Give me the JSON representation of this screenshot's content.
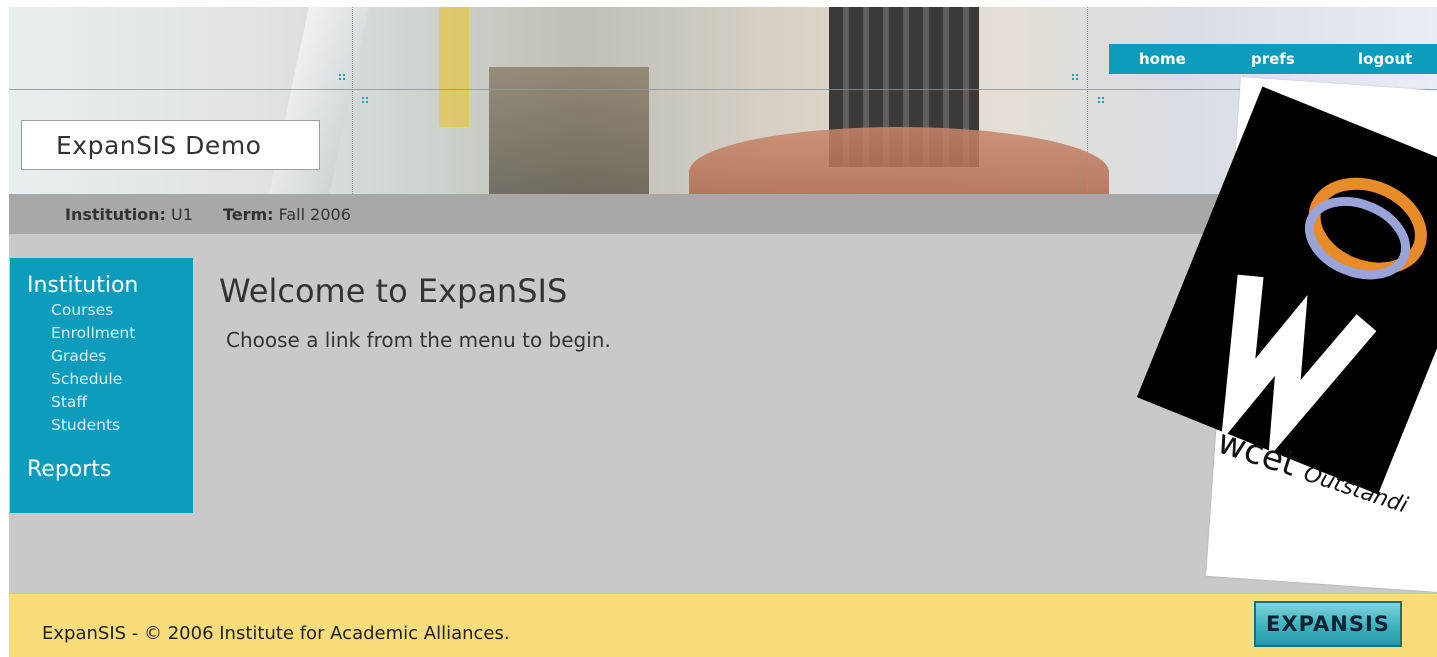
{
  "header": {
    "site_title": "ExpanSIS Demo",
    "nav": [
      {
        "label": "home"
      },
      {
        "label": "prefs"
      },
      {
        "label": "logout"
      }
    ]
  },
  "infobar": {
    "institution_label": "Institution:",
    "institution_value": "U1",
    "term_label": "Term:",
    "term_value": "Fall 2006"
  },
  "sidebar": {
    "sections": [
      {
        "title": "Institution",
        "items": [
          "Courses",
          "Enrollment",
          "Grades",
          "Schedule",
          "Staff",
          "Students"
        ]
      },
      {
        "title": "Reports",
        "items": []
      }
    ]
  },
  "main": {
    "heading": "Welcome to ExpanSIS",
    "message": "Choose a link from the menu to begin."
  },
  "footer": {
    "copyright": "ExpanSIS - © 2006 Institute for Academic Alliances.",
    "logo_text": "EXPANSIS"
  },
  "overlay_image": {
    "text_main": "wcet",
    "text_sub": "Outstandi"
  },
  "colors": {
    "accent": "#0e9cbd",
    "footer": "#f9dc7c",
    "infobar": "#a8a8a8",
    "content_bg": "#c9c9c9"
  }
}
